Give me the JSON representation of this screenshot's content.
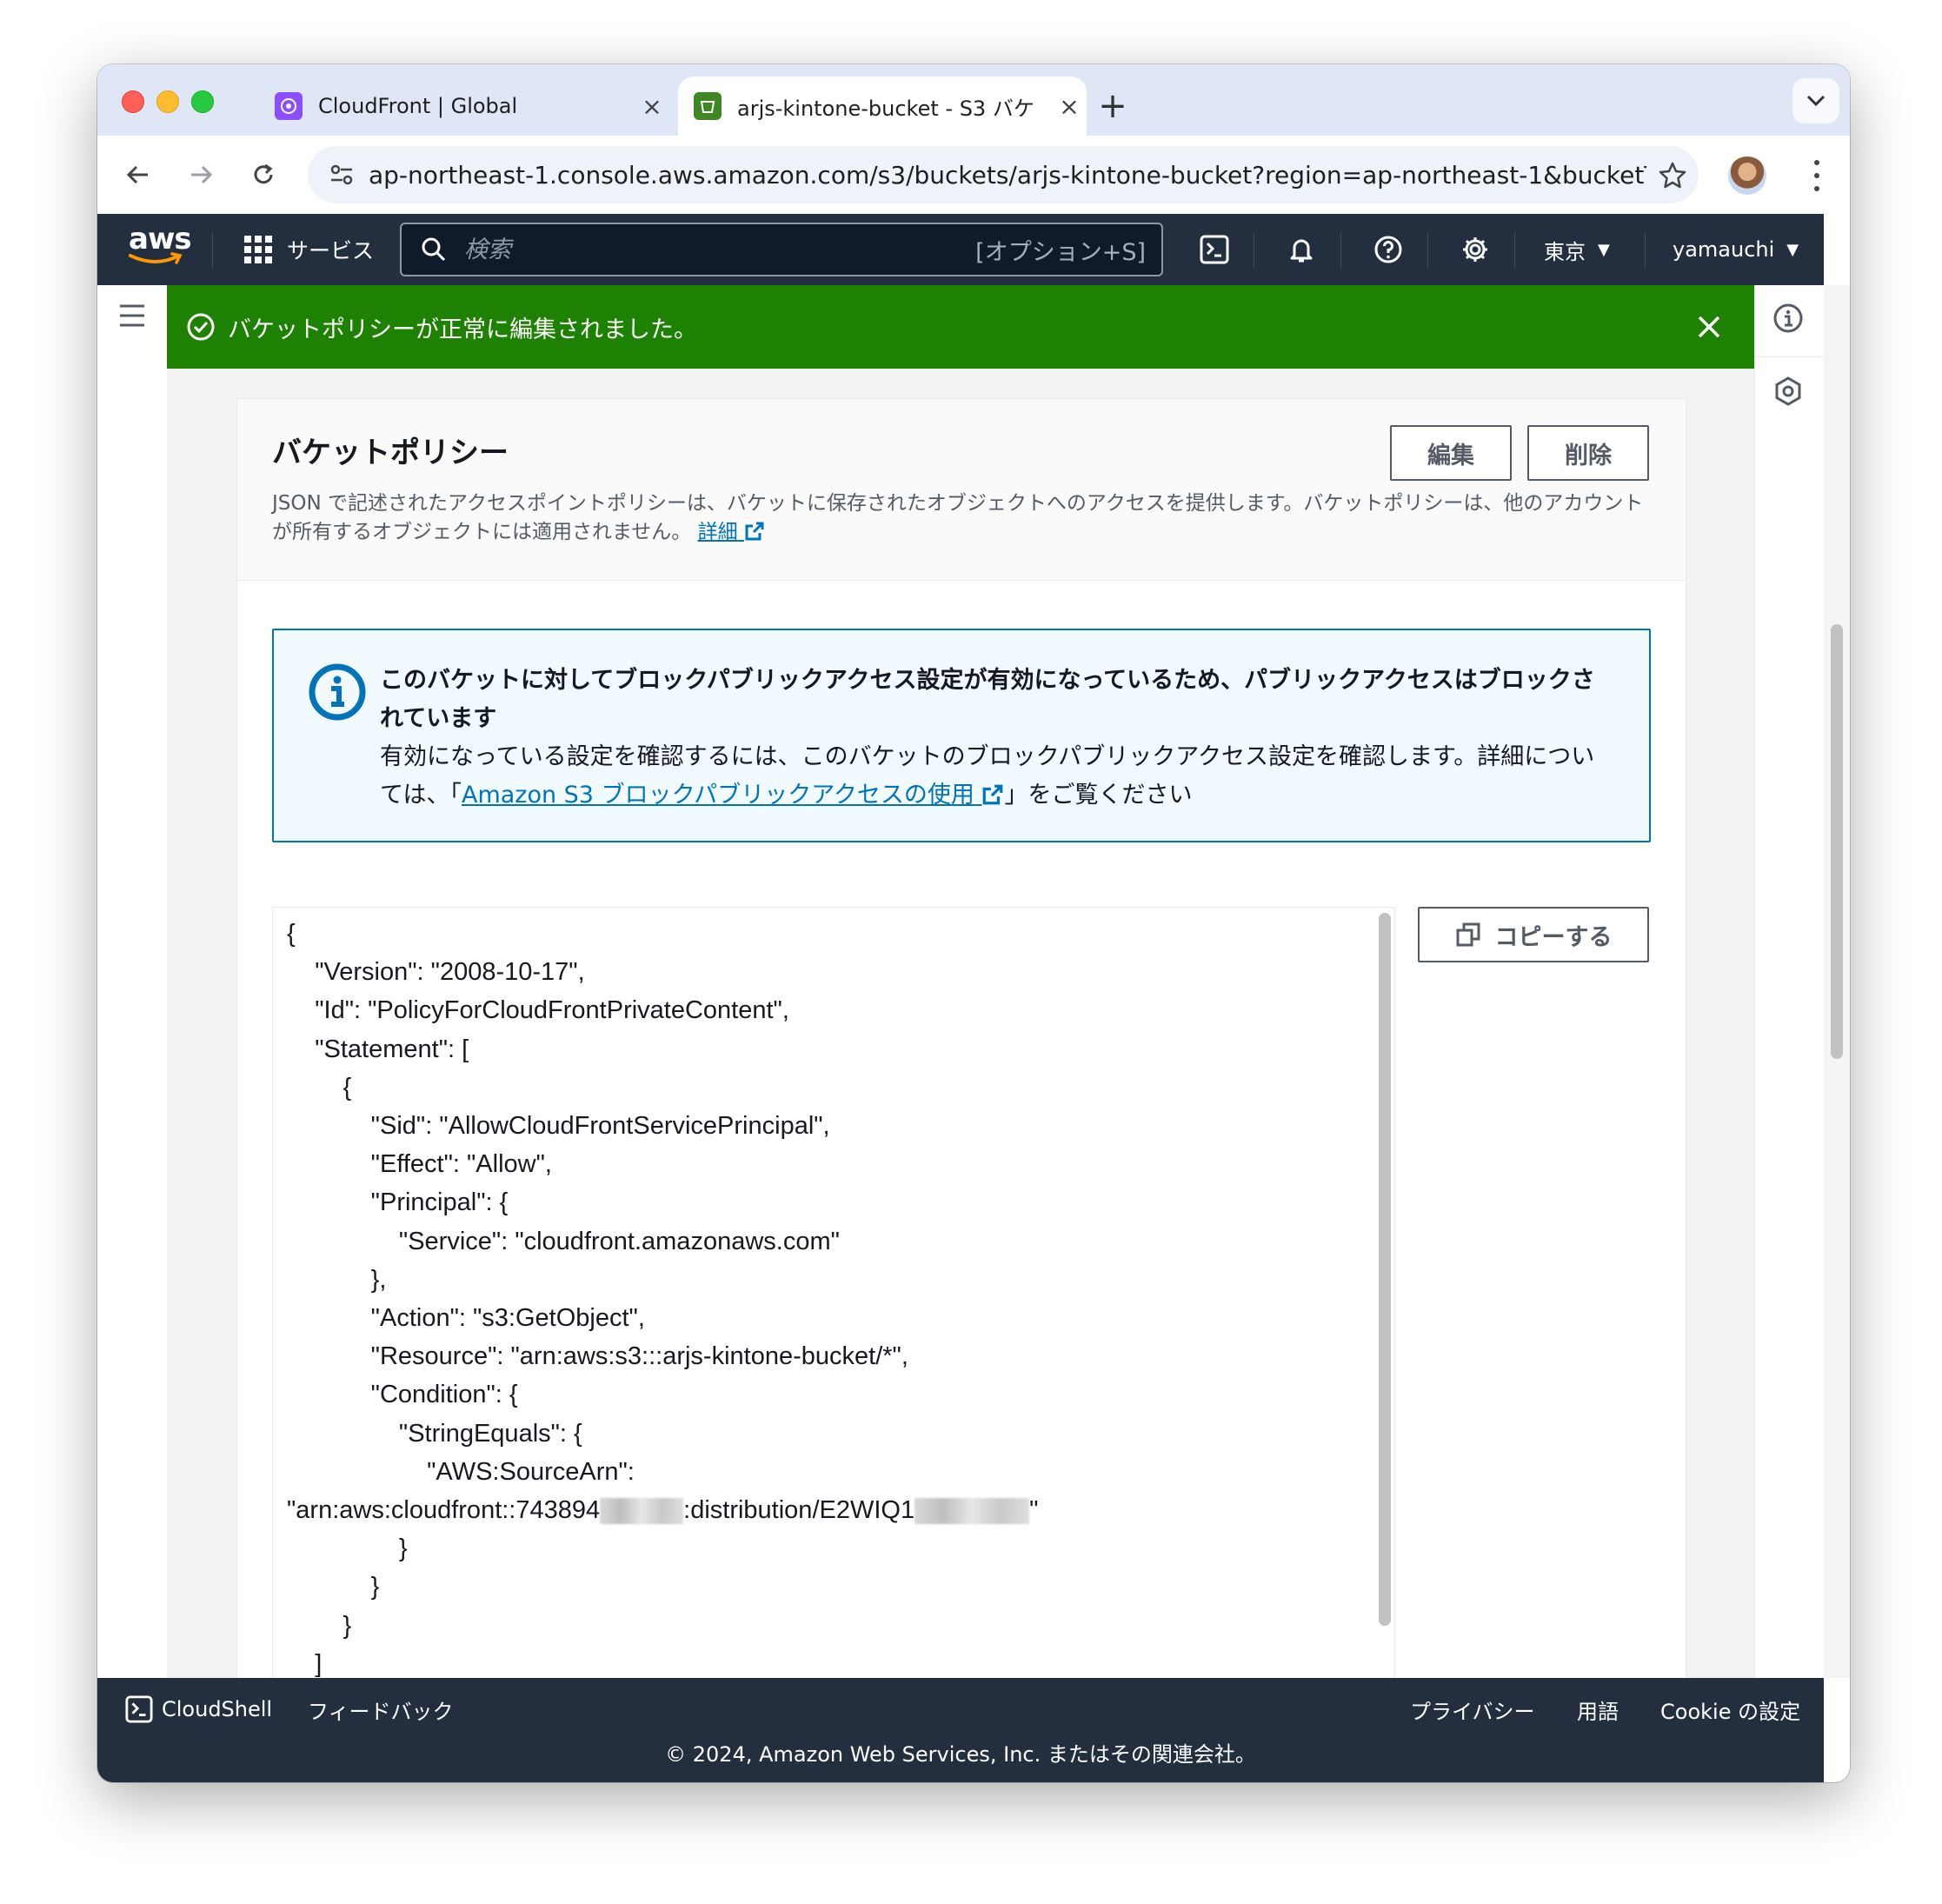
{
  "browser": {
    "tabs": [
      {
        "title": "CloudFront | Global",
        "active": false,
        "favicon": "cloudfront-icon",
        "color": "#8c4fff"
      },
      {
        "title": "arjs-kintone-bucket - S3 バケ",
        "active": true,
        "favicon": "s3-icon",
        "color": "#3f8624"
      }
    ],
    "url": "ap-northeast-1.console.aws.amazon.com/s3/buckets/arjs-kintone-bucket?region=ap-northeast-1&bucketTy..."
  },
  "aws_nav": {
    "logo_text": "aws",
    "services_label": "サービス",
    "search_placeholder": "検索",
    "search_shortcut": "[オプション+S]",
    "region": "東京",
    "user": "yamauchi"
  },
  "flash": {
    "message": "バケットポリシーが正常に編集されました。",
    "color": "#1d8102"
  },
  "policy_card": {
    "title": "バケットポリシー",
    "edit_label": "編集",
    "delete_label": "削除",
    "description": "JSON で記述されたアクセスポイントポリシーは、バケットに保存されたオブジェクトへのアクセスを提供します。バケットポリシーは、他のアカウントが所有するオブジェクトには適用されません。",
    "details_link": "詳細"
  },
  "info_alert": {
    "title": "このバケットに対してブロックパブリックアクセス設定が有効になっているため、パブリックアクセスはブロックされています",
    "body_before": "有効になっている設定を確認するには、このバケットのブロックパブリックアクセス設定を確認します。詳細については、「",
    "link": "Amazon S3 ブロックパブリックアクセスの使用",
    "body_after": "」をご覧ください"
  },
  "policy_json": {
    "lines_before": "{\n    \"Version\": \"2008-10-17\",\n    \"Id\": \"PolicyForCloudFrontPrivateContent\",\n    \"Statement\": [\n        {\n            \"Sid\": \"AllowCloudFrontServicePrincipal\",\n            \"Effect\": \"Allow\",\n            \"Principal\": {\n                \"Service\": \"cloudfront.amazonaws.com\"\n            },\n            \"Action\": \"s3:GetObject\",\n            \"Resource\": \"arn:aws:s3:::arjs-kintone-bucket/*\",\n            \"Condition\": {\n                \"StringEquals\": {\n                    \"AWS:SourceArn\":\n",
    "arn_part1": "\"arn:aws:cloudfront::743894",
    "arn_part2": ":distribution/E2WIQ1",
    "arn_part3": "\"",
    "lines_after": "                }\n            }\n        }\n    ]"
  },
  "copy_button_label": "コピーする",
  "footer": {
    "cloudshell": "CloudShell",
    "feedback": "フィードバック",
    "privacy": "プライバシー",
    "terms": "用語",
    "cookie": "Cookie の設定",
    "copyright": "© 2024, Amazon Web Services, Inc. またはその関連会社。"
  },
  "colors": {
    "aws_nav_bg": "#232f3e",
    "link": "#0073bb",
    "aws_orange": "#ff9900"
  }
}
